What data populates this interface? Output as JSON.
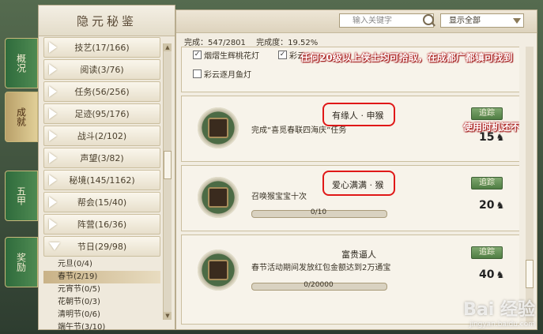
{
  "left": {
    "title": "隐元秘鉴",
    "side_tabs": [
      "概况",
      "成就",
      "五甲",
      "奖励"
    ],
    "categories": [
      {
        "label": "技艺(17/166)"
      },
      {
        "label": "阅读(3/76)"
      },
      {
        "label": "任务(56/256)"
      },
      {
        "label": "足迹(95/176)"
      },
      {
        "label": "战斗(2/102)"
      },
      {
        "label": "声望(3/82)"
      },
      {
        "label": "秘境(145/1162)"
      },
      {
        "label": "帮会(15/40)"
      },
      {
        "label": "阵营(16/36)"
      },
      {
        "label": "节日(29/98)"
      }
    ],
    "sub_items": [
      "元旦(0/4)",
      "春节(2/19)",
      "元宵节(0/5)",
      "花朝节(0/3)",
      "清明节(0/6)",
      "端午节(3/10)"
    ]
  },
  "header": {
    "search_placeholder": "输入关键字",
    "filter_value": "显示全部",
    "completed_label": "完成：547/2801",
    "completion_rate": "完成度：19.52%"
  },
  "checks": [
    {
      "label": "烟熠生辉桃花灯",
      "checked": true
    },
    {
      "label": "彩云…",
      "checked": true
    },
    {
      "label": "彩云逐月鱼灯",
      "checked": false
    }
  ],
  "overlays": {
    "banner": "任何20级以上侠士均可拾取，在成都广都镇可找到",
    "hint": "使用时机还不到"
  },
  "quests": [
    {
      "title": "有缘人 · 申猴",
      "desc": "完成“喜觅春联四海庆”任务",
      "track": "追踪",
      "points": "15"
    },
    {
      "title": "爱心满满 · 猴",
      "desc": "召唤猴宝宝十次",
      "track": "追踪",
      "points": "20",
      "progress_text": "0/10",
      "progress": 0
    },
    {
      "title": "富贵逼人",
      "desc": "春节活动期间发放红包金额达到2万通宝",
      "track": "追踪",
      "points": "40",
      "progress_text": "0/20000",
      "progress": 0
    }
  ],
  "watermark": {
    "brand": "Bai 经验",
    "url": "jingyan.baidu.com"
  }
}
